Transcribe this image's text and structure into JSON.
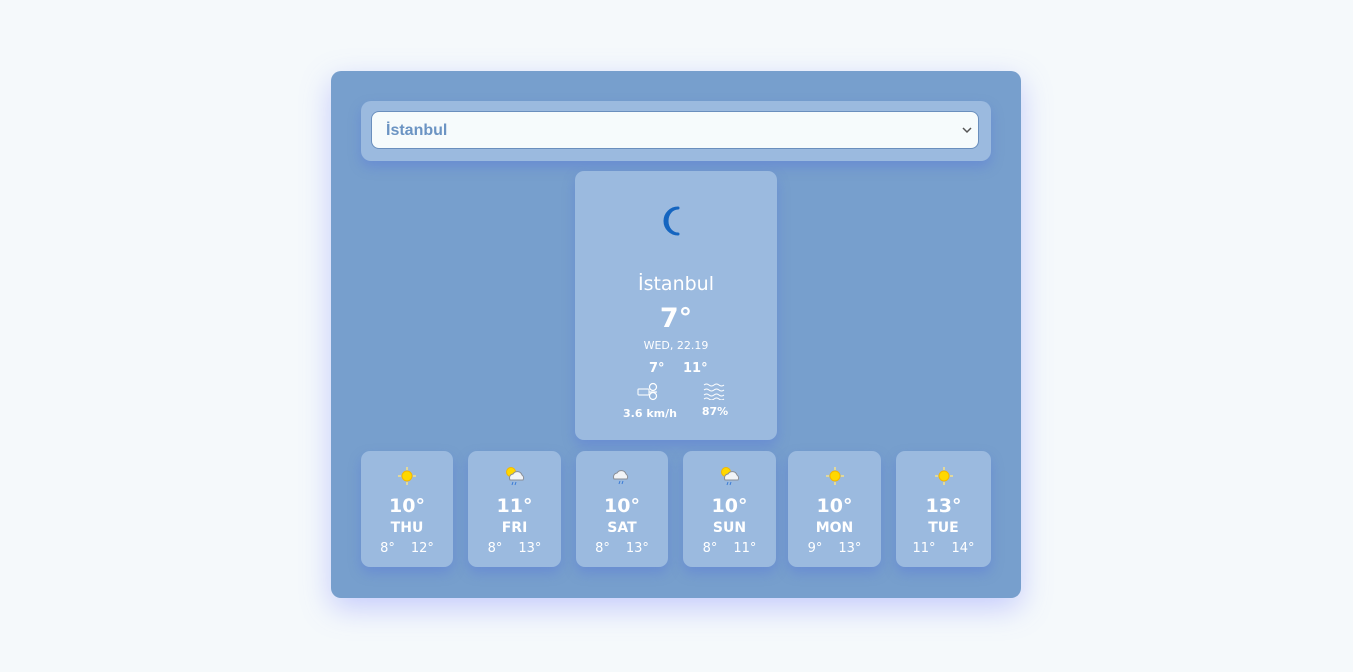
{
  "city_select": {
    "value": "İstanbul"
  },
  "current": {
    "city": "İstanbul",
    "temp": "7°",
    "date": "WED, 22.19",
    "min": "7°",
    "max": "11°",
    "wind": "3.6 km/h",
    "humidity": "87%",
    "icon": "moon-icon"
  },
  "forecast": [
    {
      "day": "THU",
      "temp": "10°",
      "min": "8°",
      "max": "12°",
      "icon": "sun-icon"
    },
    {
      "day": "FRI",
      "temp": "11°",
      "min": "8°",
      "max": "13°",
      "icon": "sun-cloud-rain-icon"
    },
    {
      "day": "SAT",
      "temp": "10°",
      "min": "8°",
      "max": "13°",
      "icon": "cloud-rain-icon"
    },
    {
      "day": "SUN",
      "temp": "10°",
      "min": "8°",
      "max": "11°",
      "icon": "sun-cloud-rain-icon"
    },
    {
      "day": "MON",
      "temp": "10°",
      "min": "9°",
      "max": "13°",
      "icon": "sun-icon"
    },
    {
      "day": "TUE",
      "temp": "13°",
      "min": "11°",
      "max": "14°",
      "icon": "sun-icon"
    }
  ],
  "colors": {
    "page_bg": "#f5f9fb",
    "panel": "#779fcd",
    "card": "#9bbadf",
    "select_text": "#6b94c3",
    "moon": "#1565c0",
    "sun": "#ffd800"
  }
}
